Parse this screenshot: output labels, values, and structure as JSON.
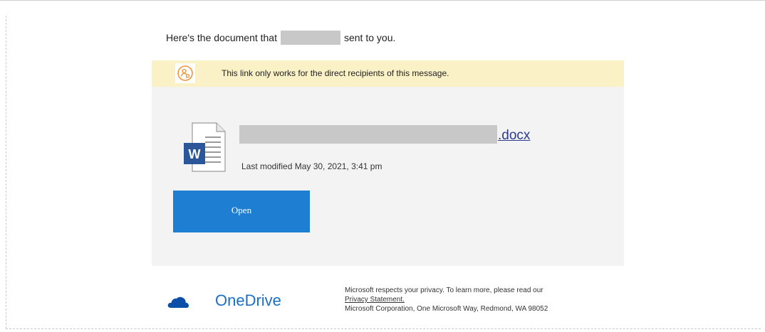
{
  "greeting": {
    "before": "Here's the document that",
    "after": "sent to you."
  },
  "notice": {
    "icon": "person-link-icon",
    "text": "This link only works for the direct recipients of this message."
  },
  "document": {
    "icon": "word-document-icon",
    "extension": ".docx",
    "last_modified": "Last modified May 30, 2021, 3:41 pm",
    "open_label": "Open"
  },
  "footer": {
    "brand_icon": "onedrive-cloud-icon",
    "brand": "OneDrive",
    "privacy_line": "Microsoft respects your privacy. To learn more, please read our",
    "privacy_link": "Privacy Statement.",
    "address": "Microsoft Corporation, One Microsoft Way, Redmond, WA 98052"
  },
  "colors": {
    "notice_bg": "#fbf1c7",
    "card_bg": "#f3f3f3",
    "button_bg": "#1e7fd2",
    "brand_blue": "#1a6fc4",
    "word_blue": "#2b579a",
    "notice_icon": "#f0963a"
  }
}
